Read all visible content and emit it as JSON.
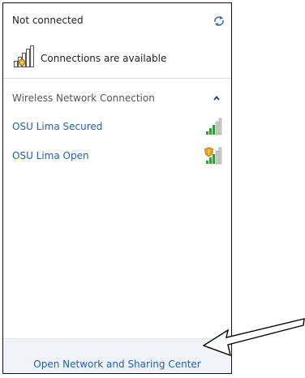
{
  "status": {
    "title": "Not connected",
    "connections_label": "Connections are available"
  },
  "section": {
    "label": "Wireless Network Connection",
    "state": "expanded"
  },
  "networks": [
    {
      "name": "OSU Lima Secured",
      "security": "secured",
      "signal_bars": 5
    },
    {
      "name": "OSU Lima Open",
      "security": "open",
      "signal_bars": 5
    }
  ],
  "footer": {
    "link_label": "Open Network and Sharing Center"
  },
  "icons": {
    "refresh": "refresh-icon",
    "connections": "signal-bars-icon",
    "collapse": "chevron-up-icon",
    "open_network": "warning-shield-icon"
  },
  "colors": {
    "link": "#1f5fb5",
    "signal_bar": "#3c9a3c",
    "signal_empty": "#c2c2c2",
    "warning": "#e9a21b",
    "footer_bg": "#f0f4fa"
  }
}
